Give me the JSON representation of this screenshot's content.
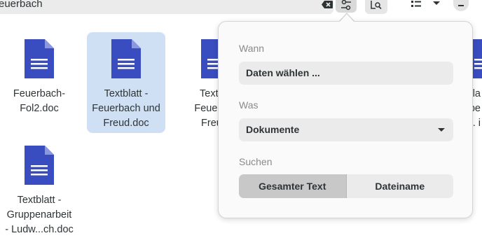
{
  "toolbar": {
    "search_text": "euerbach"
  },
  "files": [
    {
      "name": "Feuerbach-\nFol2.doc",
      "selected": false
    },
    {
      "name": "Textblatt -\nFeuerbach und\nFreud.doc",
      "selected": true
    },
    {
      "name": "Textbla\nFeuerbac\nFreud.",
      "selected": false
    },
    {
      "name": "Textblatt -\nGruppenarbeit\n- Ludw...ch.doc",
      "selected": false
    },
    {
      "name": "bla\nrbe\n.. i",
      "selected": false
    }
  ],
  "popover": {
    "when_label": "Wann",
    "when_value": "Daten wählen ...",
    "what_label": "Was",
    "what_value": "Dokumente",
    "search_label": "Suchen",
    "search_full_text": "Gesamter Text",
    "search_filename": "Dateiname"
  },
  "colors": {
    "doc_icon": "#3a4dc0",
    "selection": "#cfe0f5"
  }
}
